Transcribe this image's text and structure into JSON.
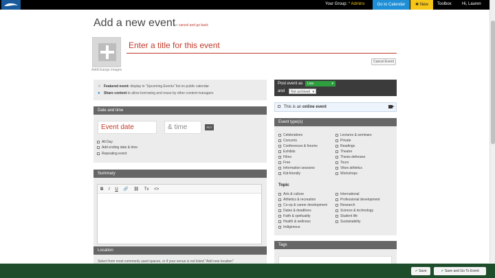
{
  "topbar": {
    "group_label": "Your Group:",
    "group_value": "* Admins",
    "calendar_button": "Go to Calendar",
    "new_button": "New",
    "toolbox": "Toolbox",
    "user_greeting": "Hi, Lauren"
  },
  "header": {
    "title": "Add a new event",
    "cancel_prefix": "or",
    "cancel_link": "cancel and go back"
  },
  "image": {
    "label": "Add/change images"
  },
  "title_input": {
    "placeholder": "Enter a title for this event"
  },
  "cancel_event_button": "Cancel Event",
  "featured": {
    "featured_bold": "Featured event:",
    "featured_text": "display in \"Upcoming Events\" list on public calendar",
    "share_bold": "Share content",
    "share_text": "to allow borrowing and reuse by other content managers"
  },
  "date_time": {
    "header": "Date and time",
    "event_date_placeholder": "Event date",
    "time_placeholder": "& time",
    "timezone": "PDT",
    "options": [
      "All Day",
      "Add ending date & time",
      "Repeating event"
    ]
  },
  "summary": {
    "header": "Summary",
    "tools": [
      "B",
      "I",
      "U",
      "🔗",
      "⛓",
      "Tx",
      "<>"
    ]
  },
  "location": {
    "header": "Location",
    "help": "Select from most commonly used spaces, or if your venue is not listed \"Add new location\""
  },
  "post": {
    "label": "Post event as",
    "status": "Live",
    "and_label": "and",
    "archive": "Not archived"
  },
  "online": {
    "prefix": "This is an",
    "bold": "online event"
  },
  "event_types": {
    "header": "Event type(s)",
    "col1": [
      "Celebrations",
      "Concerts",
      "Conferences & forums",
      "Exhibits",
      "Films",
      "Free",
      "Information sessions",
      "Kid-friendly"
    ],
    "col2": [
      "Lectures & seminars",
      "Private",
      "Readings",
      "Theatre",
      "Thesis defenses",
      "Tours",
      "Vikes athletics",
      "Workshops"
    ],
    "topic_label": "Topic",
    "topic_col1": [
      "Arts & culture",
      "Athletics & recreation",
      "Co-op & career development",
      "Dates & deadlines",
      "Faith & spirituality",
      "Health & wellness",
      "Indigenous"
    ],
    "topic_col2": [
      "International",
      "Professional development",
      "Research",
      "Science & technology",
      "Student life",
      "Sustainability"
    ]
  },
  "tags": {
    "header": "Tags"
  },
  "footer": {
    "save": "Save",
    "save_go": "Save and Go To Event"
  }
}
